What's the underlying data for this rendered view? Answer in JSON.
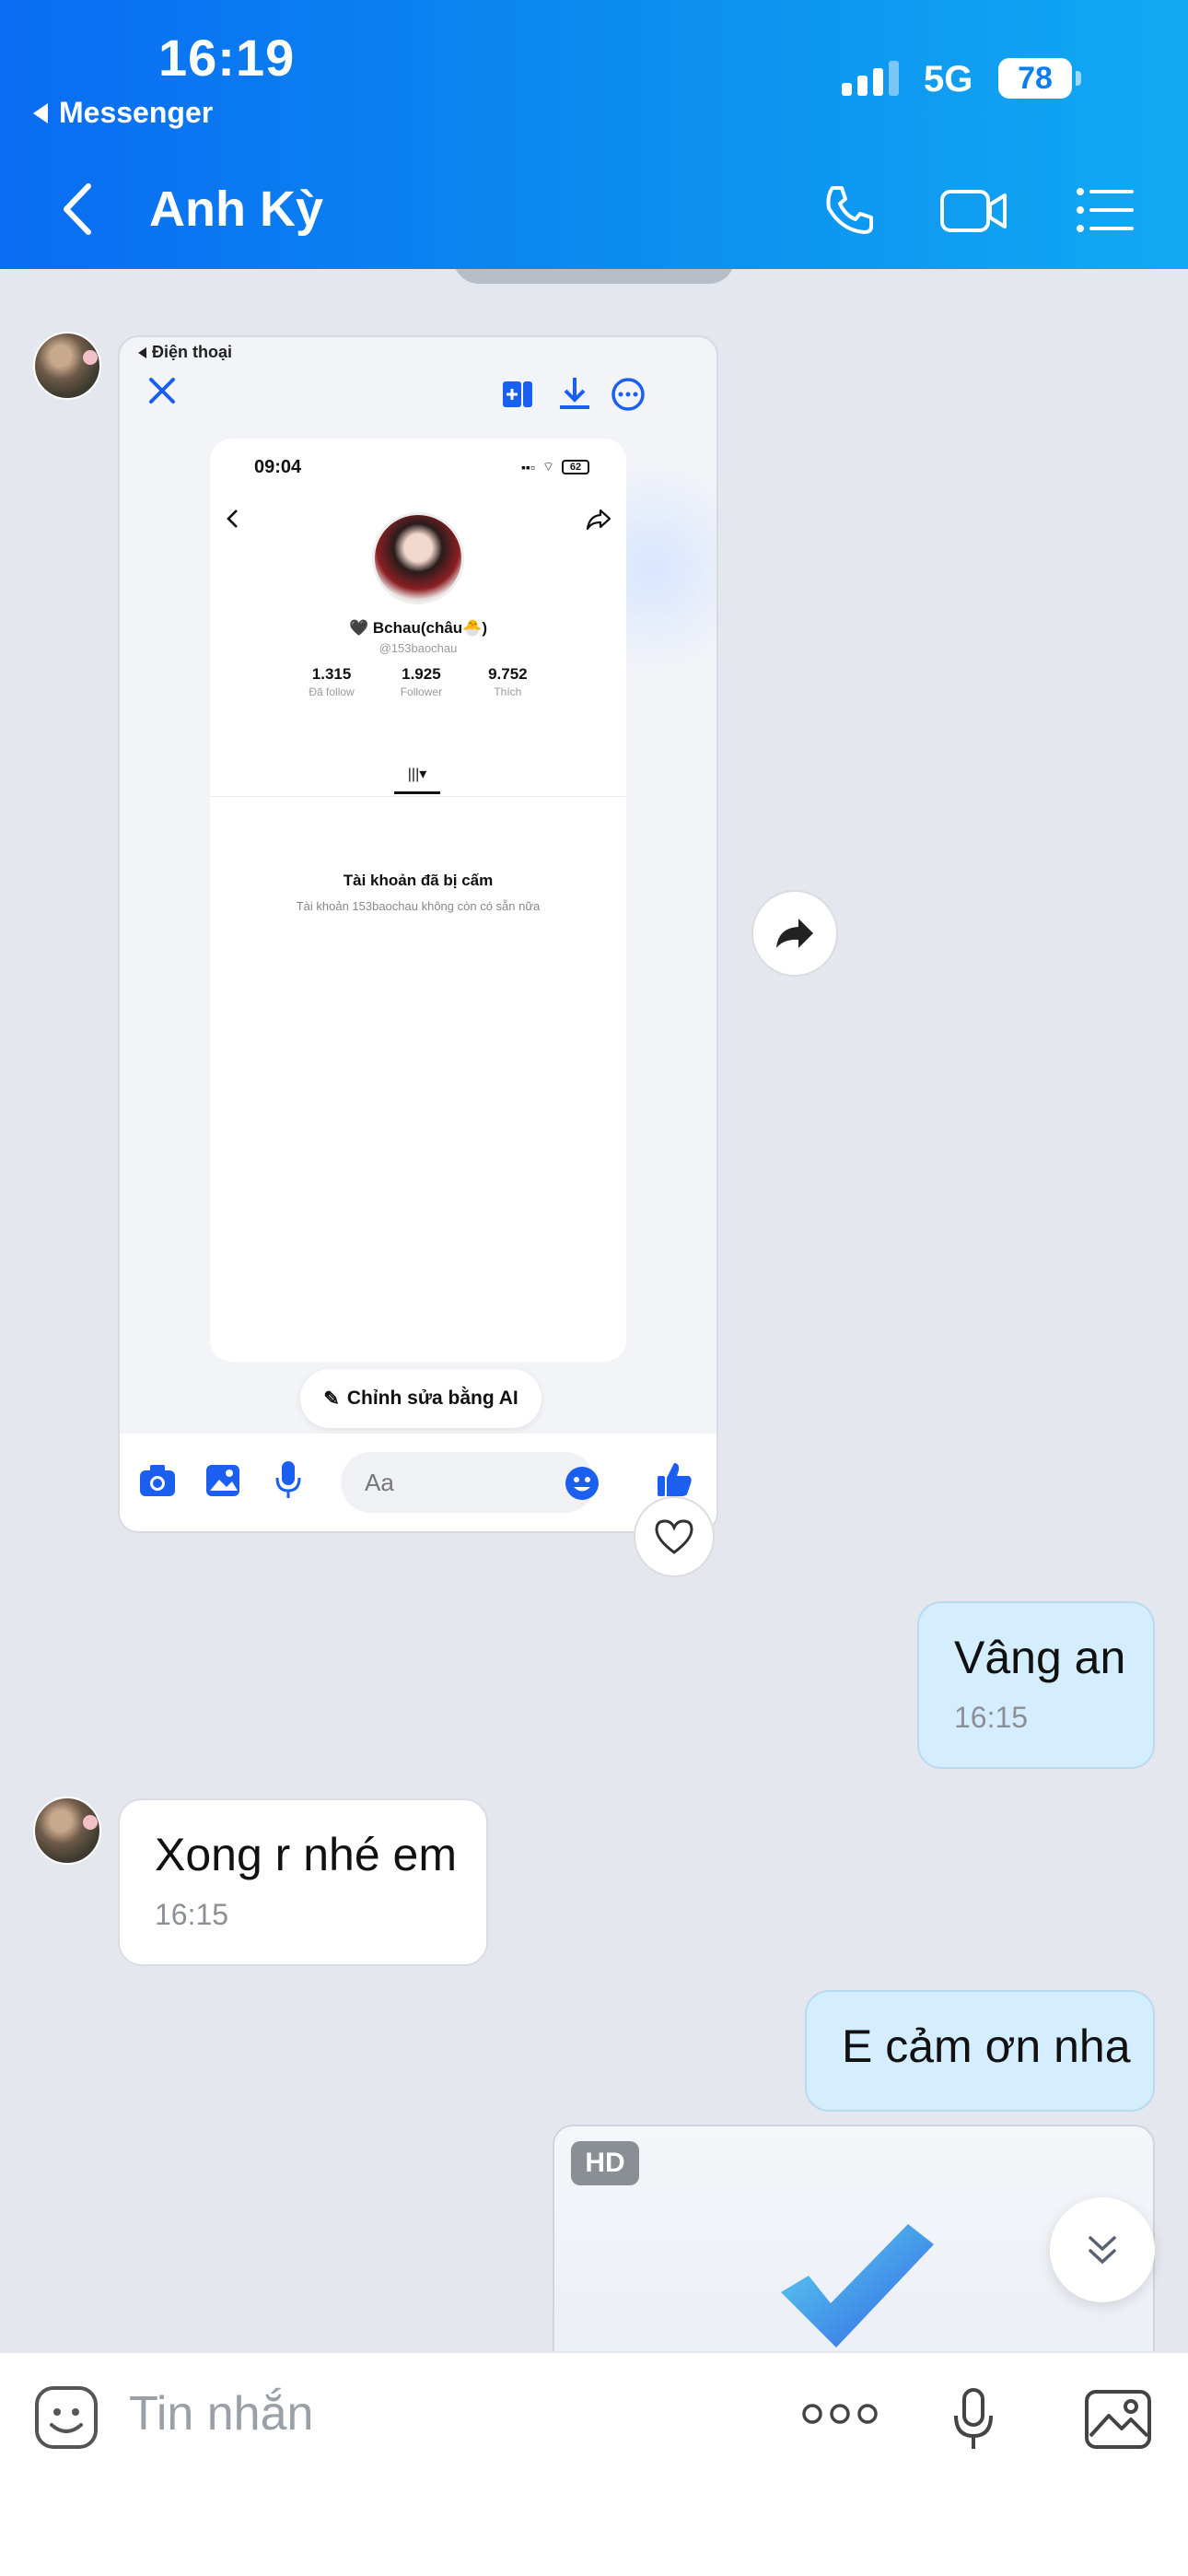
{
  "status_bar": {
    "time": "16:19",
    "back_app": "Messenger",
    "network": "5G",
    "battery": "78"
  },
  "header": {
    "contact_name": "Anh Kỳ",
    "icons": [
      "back-icon",
      "phone-icon",
      "video-call-icon",
      "menu-list-icon"
    ]
  },
  "embedded_screenshot": {
    "status_label": "Điện thoại",
    "phone_time": "09:04",
    "phone_battery": "62",
    "profile_name": "🖤 Bchau(châu🐣)",
    "profile_handle": "@153baochau",
    "stats": [
      {
        "value": "1.315",
        "label": "Đã follow"
      },
      {
        "value": "1.925",
        "label": "Follower"
      },
      {
        "value": "9.752",
        "label": "Thích"
      }
    ],
    "banned_title": "Tài khoản đã bị cấm",
    "banned_sub": "Tài khoản 153baochau không còn có sẵn nữa",
    "ai_edit_label": "Chỉnh sửa bằng AI",
    "input_placeholder": "Aa"
  },
  "messages": [
    {
      "direction": "out",
      "text": "Vâng an",
      "time": "16:15"
    },
    {
      "direction": "in",
      "text": "Xong r nhé em",
      "time": "16:15"
    },
    {
      "direction": "out",
      "text": "E cảm ơn nha",
      "time": ""
    }
  ],
  "media_badge": "HD",
  "composer": {
    "placeholder": "Tin nhắn"
  },
  "colors": {
    "header_start": "#0a6cf2",
    "header_end": "#12a9f2",
    "outgoing_bubble": "#d4eeff",
    "incoming_bubble": "#ffffff",
    "chat_bg": "#e4e8ee"
  }
}
